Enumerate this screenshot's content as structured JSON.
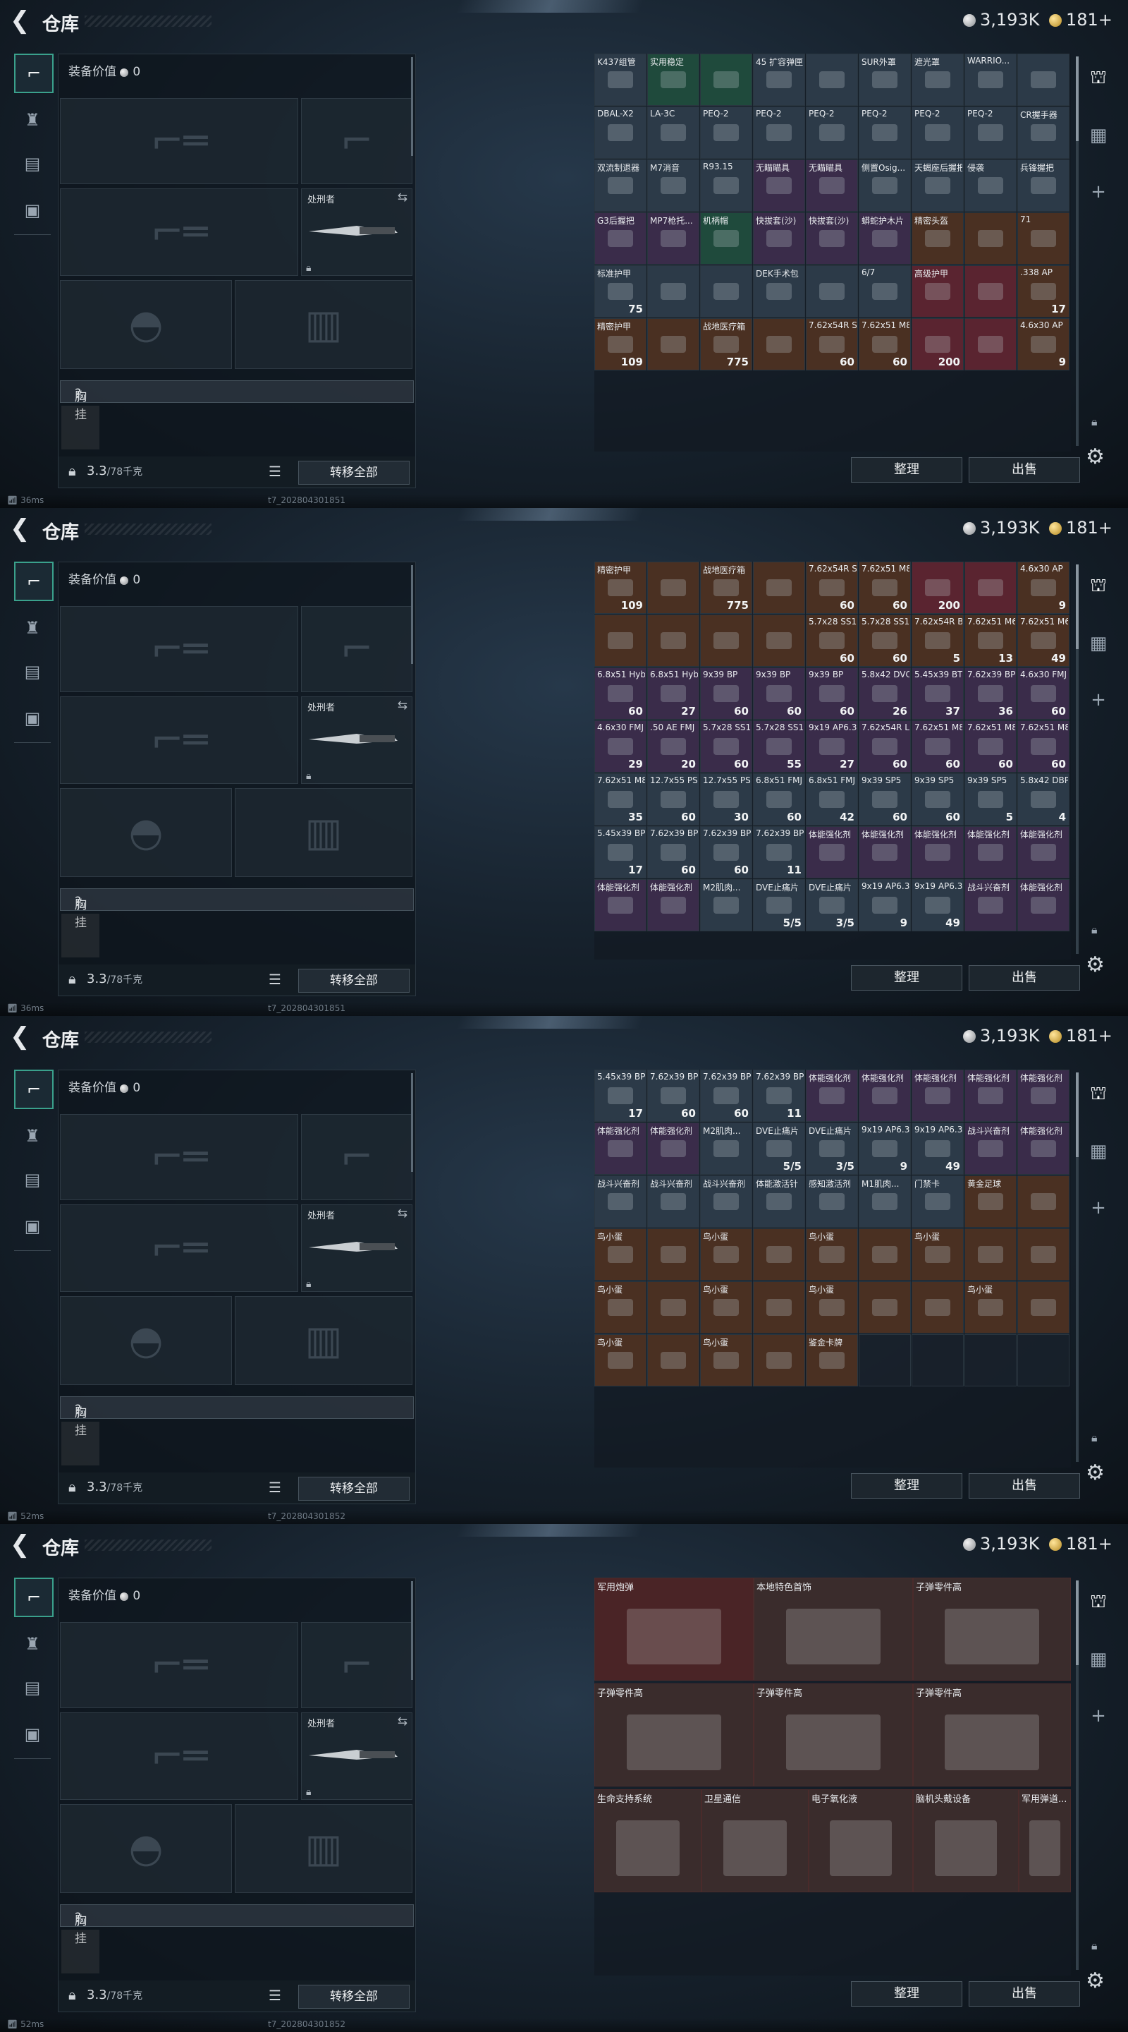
{
  "title": "仓库",
  "currency": {
    "silver": "3,193K",
    "gold": "181+"
  },
  "loadout": {
    "equip_value_label": "装备价值",
    "equip_value": "0",
    "knife_label": "处刑者",
    "vest_label": "胸挂",
    "vest_help": "?",
    "weight": "3.3",
    "weight_cap": "/78千克",
    "transfer_all": "转移全部"
  },
  "buttons": {
    "sort": "整理",
    "sell": "出售"
  },
  "frames": [
    {
      "ping": "36ms",
      "build": "t7_202804301851",
      "cells": [
        {
          "name": "K437组管",
          "color": "#2c3a48"
        },
        {
          "name": "实用稳定",
          "color": "#1f4a3c"
        },
        {
          "name": "",
          "color": "#1f4a3c"
        },
        {
          "name": "45 扩容弹匣",
          "color": "#2c3a48"
        },
        {
          "name": "",
          "color": "#2c3a48"
        },
        {
          "name": "SUR外罩",
          "color": "#2c3a48"
        },
        {
          "name": "遮光罩",
          "color": "#2c3a48"
        },
        {
          "name": "WARRIO...",
          "color": "#2c3a48"
        },
        {
          "name": "",
          "color": "#2c3a48"
        },
        {
          "name": "DBAL-X2",
          "color": "#2c3a48"
        },
        {
          "name": "LA-3C",
          "color": "#2c3a48"
        },
        {
          "name": "PEQ-2",
          "color": "#2c3a48"
        },
        {
          "name": "PEQ-2",
          "color": "#2c3a48"
        },
        {
          "name": "PEQ-2",
          "color": "#2c3a48"
        },
        {
          "name": "PEQ-2",
          "color": "#2c3a48"
        },
        {
          "name": "PEQ-2",
          "color": "#2c3a48"
        },
        {
          "name": "PEQ-2",
          "color": "#2c3a48"
        },
        {
          "name": "CR握手器",
          "color": "#2c3a48"
        },
        {
          "name": "双流制退器",
          "color": "#2c3a48"
        },
        {
          "name": "M7消音",
          "color": "#2c3a48"
        },
        {
          "name": "R93.15",
          "color": "#2c3a48"
        },
        {
          "name": "无瞄瞄具",
          "color": "#3a2c4a"
        },
        {
          "name": "无瞄瞄具",
          "color": "#3a2c4a"
        },
        {
          "name": "侧置Osig...",
          "color": "#2c3a48"
        },
        {
          "name": "天蝎座后握把",
          "color": "#2c3a48"
        },
        {
          "name": "侵袭",
          "color": "#2c3a48"
        },
        {
          "name": "兵锋握把",
          "color": "#2c3a48"
        },
        {
          "name": "G3后握把",
          "color": "#3a2c4a"
        },
        {
          "name": "MP7枪托...",
          "color": "#3a2c4a"
        },
        {
          "name": "机柄帽",
          "color": "#1f4a3c"
        },
        {
          "name": "快拔套(沙)",
          "color": "#3a2c4a"
        },
        {
          "name": "快拔套(沙)",
          "color": "#3a2c4a"
        },
        {
          "name": "蟒蛇护木片",
          "color": "#3a2c4a"
        },
        {
          "name": "精密头盔",
          "color": "#4a3022"
        },
        {
          "name": "",
          "color": "#4a3022"
        },
        {
          "name": "71",
          "color": "#4a3022"
        },
        {
          "name": "标准护甲",
          "color": "#2c3a48",
          "count": "75"
        },
        {
          "name": "",
          "color": "#2c3a48"
        },
        {
          "name": "",
          "color": "#2c3a48"
        },
        {
          "name": "DEK手术包",
          "color": "#2c3a48"
        },
        {
          "name": "",
          "color": "#2c3a48"
        },
        {
          "name": "6/7",
          "color": "#2c3a48"
        },
        {
          "name": "高级护甲",
          "color": "#5a2430"
        },
        {
          "name": "",
          "color": "#5a2430"
        },
        {
          "name": ".338 AP",
          "color": "#4a3022",
          "count": "17"
        },
        {
          "name": "精密护甲",
          "color": "#4a3022",
          "count": "109"
        },
        {
          "name": "",
          "color": "#4a3022"
        },
        {
          "name": "战地医疗箱",
          "color": "#4a3022",
          "count": "775"
        },
        {
          "name": "",
          "color": "#4a3022"
        },
        {
          "name": "7.62x54R SNB",
          "color": "#4a3022",
          "count": "60"
        },
        {
          "name": "7.62x51 M80",
          "color": "#4a3022",
          "count": "60"
        },
        {
          "name": "",
          "color": "#5a2430",
          "count": "200"
        },
        {
          "name": "",
          "color": "#5a2430"
        },
        {
          "name": "4.6x30 AP",
          "color": "#4a3022",
          "count": "9"
        }
      ]
    },
    {
      "ping": "36ms",
      "build": "t7_202804301851",
      "cells": [
        {
          "name": "精密护甲",
          "color": "#4a3022",
          "count": "109"
        },
        {
          "name": "",
          "color": "#4a3022"
        },
        {
          "name": "战地医疗箱",
          "color": "#4a3022",
          "count": "775"
        },
        {
          "name": "",
          "color": "#4a3022"
        },
        {
          "name": "7.62x54R SNB",
          "color": "#4a3022",
          "count": "60"
        },
        {
          "name": "7.62x51 M80",
          "color": "#4a3022",
          "count": "60"
        },
        {
          "name": "",
          "color": "#5a2430",
          "count": "200"
        },
        {
          "name": "",
          "color": "#5a2430"
        },
        {
          "name": "4.6x30 AP",
          "color": "#4a3022",
          "count": "9"
        },
        {
          "name": "",
          "color": "#4a3022"
        },
        {
          "name": "",
          "color": "#4a3022"
        },
        {
          "name": "",
          "color": "#4a3022"
        },
        {
          "name": "",
          "color": "#4a3022"
        },
        {
          "name": "5.7x28 SS193",
          "color": "#4a3022",
          "count": "60"
        },
        {
          "name": "5.7x28 SS190",
          "color": "#4a3022",
          "count": "60"
        },
        {
          "name": "7.62x54R BT",
          "color": "#4a3022",
          "count": "5"
        },
        {
          "name": "7.62x51 M62",
          "color": "#4a3022",
          "count": "13"
        },
        {
          "name": "7.62x51 M61",
          "color": "#4a3022",
          "count": "49"
        },
        {
          "name": "6.8x51 Hybrid",
          "color": "#3a2c4a",
          "count": "60"
        },
        {
          "name": "6.8x51 Hybrid",
          "color": "#3a2c4a",
          "count": "27"
        },
        {
          "name": "9x39 BP",
          "color": "#3a2c4a",
          "count": "60"
        },
        {
          "name": "9x39 BP",
          "color": "#3a2c4a",
          "count": "60"
        },
        {
          "name": "9x39 BP",
          "color": "#3a2c4a",
          "count": "60"
        },
        {
          "name": "5.8x42 DVC",
          "color": "#3a2c4a",
          "count": "26"
        },
        {
          "name": "5.45x39 BT",
          "color": "#3a2c4a",
          "count": "37"
        },
        {
          "name": "7.62x39 BP",
          "color": "#3a2c4a",
          "count": "36"
        },
        {
          "name": "4.6x30 FMJ",
          "color": "#3a2c4a",
          "count": "60"
        },
        {
          "name": "4.6x30 FMJ",
          "color": "#3a2c4a",
          "count": "29"
        },
        {
          "name": ".50 AE FMJ",
          "color": "#3a2c4a",
          "count": "20"
        },
        {
          "name": "5.7x28 SS197",
          "color": "#3a2c4a",
          "count": "60"
        },
        {
          "name": "5.7x28 SS197",
          "color": "#3a2c4a",
          "count": "55"
        },
        {
          "name": "9x19 AP6.3",
          "color": "#3a2c4a",
          "count": "27"
        },
        {
          "name": "7.62x54R LPS",
          "color": "#3a2c4a",
          "count": "60"
        },
        {
          "name": "7.62x51 M80",
          "color": "#3a2c4a",
          "count": "60"
        },
        {
          "name": "7.62x51 M80",
          "color": "#3a2c4a",
          "count": "60"
        },
        {
          "name": "7.62x51 M80",
          "color": "#3a2c4a",
          "count": "60"
        },
        {
          "name": "7.62x51 M80",
          "color": "#2c3a48",
          "count": "35"
        },
        {
          "name": "12.7x55 PS12",
          "color": "#2c3a48",
          "count": "60"
        },
        {
          "name": "12.7x55 PS12",
          "color": "#2c3a48",
          "count": "30"
        },
        {
          "name": "6.8x51 FMJ",
          "color": "#2c3a48",
          "count": "60"
        },
        {
          "name": "6.8x51 FMJ",
          "color": "#2c3a48",
          "count": "42"
        },
        {
          "name": "9x39 SP5",
          "color": "#2c3a48",
          "count": "60"
        },
        {
          "name": "9x39 SP5",
          "color": "#2c3a48",
          "count": "60"
        },
        {
          "name": "9x39 SP5",
          "color": "#2c3a48",
          "count": "5"
        },
        {
          "name": "5.8x42 DBP88",
          "color": "#2c3a48",
          "count": "4"
        },
        {
          "name": "5.45x39 BP",
          "color": "#2c3a48",
          "count": "17"
        },
        {
          "name": "7.62x39 BP",
          "color": "#2c3a48",
          "count": "60"
        },
        {
          "name": "7.62x39 BP",
          "color": "#2c3a48",
          "count": "60"
        },
        {
          "name": "7.62x39 BP",
          "color": "#2c3a48",
          "count": "11"
        },
        {
          "name": "体能强化剂",
          "color": "#3a2c4a"
        },
        {
          "name": "体能强化剂",
          "color": "#3a2c4a"
        },
        {
          "name": "体能强化剂",
          "color": "#3a2c4a"
        },
        {
          "name": "体能强化剂",
          "color": "#3a2c4a"
        },
        {
          "name": "体能强化剂",
          "color": "#3a2c4a"
        },
        {
          "name": "体能强化剂",
          "color": "#3a2c4a"
        },
        {
          "name": "体能强化剂",
          "color": "#3a2c4a"
        },
        {
          "name": "M2肌肉...",
          "color": "#2c3a48"
        },
        {
          "name": "DVE止痛片",
          "color": "#2c3a48",
          "count": "5/5"
        },
        {
          "name": "DVE止痛片",
          "color": "#2c3a48",
          "count": "3/5"
        },
        {
          "name": "9x19 AP6.3",
          "color": "#2c3a48",
          "count": "9"
        },
        {
          "name": "9x19 AP6.3",
          "color": "#2c3a48",
          "count": "49"
        },
        {
          "name": "战斗兴奋剂",
          "color": "#3a2c4a"
        },
        {
          "name": "体能强化剂",
          "color": "#3a2c4a"
        }
      ]
    },
    {
      "ping": "52ms",
      "build": "t7_202804301852",
      "cells": [
        {
          "name": "5.45x39 BP",
          "color": "#2c3a48",
          "count": "17"
        },
        {
          "name": "7.62x39 BP",
          "color": "#2c3a48",
          "count": "60"
        },
        {
          "name": "7.62x39 BP",
          "color": "#2c3a48",
          "count": "60"
        },
        {
          "name": "7.62x39 BP",
          "color": "#2c3a48",
          "count": "11"
        },
        {
          "name": "体能强化剂",
          "color": "#3a2c4a"
        },
        {
          "name": "体能强化剂",
          "color": "#3a2c4a"
        },
        {
          "name": "体能强化剂",
          "color": "#3a2c4a"
        },
        {
          "name": "体能强化剂",
          "color": "#3a2c4a"
        },
        {
          "name": "体能强化剂",
          "color": "#3a2c4a"
        },
        {
          "name": "体能强化剂",
          "color": "#3a2c4a"
        },
        {
          "name": "体能强化剂",
          "color": "#3a2c4a"
        },
        {
          "name": "M2肌肉...",
          "color": "#2c3a48"
        },
        {
          "name": "DVE止痛片",
          "color": "#2c3a48",
          "count": "5/5"
        },
        {
          "name": "DVE止痛片",
          "color": "#2c3a48",
          "count": "3/5"
        },
        {
          "name": "9x19 AP6.3",
          "color": "#2c3a48",
          "count": "9"
        },
        {
          "name": "9x19 AP6.3",
          "color": "#2c3a48",
          "count": "49"
        },
        {
          "name": "战斗兴奋剂",
          "color": "#3a2c4a"
        },
        {
          "name": "体能强化剂",
          "color": "#3a2c4a"
        },
        {
          "name": "战斗兴奋剂",
          "color": "#2c3a48"
        },
        {
          "name": "战斗兴奋剂",
          "color": "#2c3a48"
        },
        {
          "name": "战斗兴奋剂",
          "color": "#2c3a48"
        },
        {
          "name": "体能激活针",
          "color": "#2c3a48"
        },
        {
          "name": "感知激活剂",
          "color": "#2c3a48"
        },
        {
          "name": "M1肌肉...",
          "color": "#2c3a48"
        },
        {
          "name": "门禁卡",
          "color": "#2c3a48"
        },
        {
          "name": "黄金足球",
          "color": "#4a3022"
        },
        {
          "name": "",
          "color": "#4a3022"
        },
        {
          "name": "鸟小蛋",
          "color": "#4a3022"
        },
        {
          "name": "",
          "color": "#4a3022"
        },
        {
          "name": "鸟小蛋",
          "color": "#4a3022"
        },
        {
          "name": "",
          "color": "#4a3022"
        },
        {
          "name": "鸟小蛋",
          "color": "#4a3022"
        },
        {
          "name": "",
          "color": "#4a3022"
        },
        {
          "name": "鸟小蛋",
          "color": "#4a3022"
        },
        {
          "name": "",
          "color": "#4a3022"
        },
        {
          "name": "",
          "color": "#4a3022"
        },
        {
          "name": "鸟小蛋",
          "color": "#4a3022"
        },
        {
          "name": "",
          "color": "#4a3022"
        },
        {
          "name": "鸟小蛋",
          "color": "#4a3022"
        },
        {
          "name": "",
          "color": "#4a3022"
        },
        {
          "name": "鸟小蛋",
          "color": "#4a3022"
        },
        {
          "name": "",
          "color": "#4a3022"
        },
        {
          "name": "",
          "color": "#4a3022"
        },
        {
          "name": "鸟小蛋",
          "color": "#4a3022"
        },
        {
          "name": "",
          "color": "#4a3022"
        },
        {
          "name": "鸟小蛋",
          "color": "#4a3022"
        },
        {
          "name": "",
          "color": "#4a3022"
        },
        {
          "name": "鸟小蛋",
          "color": "#4a3022"
        },
        {
          "name": "",
          "color": "#4a3022"
        },
        {
          "name": "鉴金卡牌",
          "color": "#4a3022"
        },
        {
          "name": "",
          "color": "empty"
        },
        {
          "name": "",
          "color": "empty"
        },
        {
          "name": "",
          "color": "empty"
        },
        {
          "name": "",
          "color": "empty"
        }
      ]
    },
    {
      "ping": "52ms",
      "build": "t7_202804301852",
      "big": [
        {
          "name": "军用炮弹",
          "color": "#4a2426"
        },
        {
          "name": "本地特色首饰",
          "color": "#3a2c2c"
        },
        {
          "name": "子弹零件高",
          "color": "#3a2c2c"
        },
        {
          "name": "子弹零件高",
          "color": "#3a2c2c"
        },
        {
          "name": "子弹零件高",
          "color": "#3a2c2c"
        },
        {
          "name": "子弹零件高",
          "color": "#3a2c2c"
        },
        {
          "name": "生命支持系统",
          "color": "#3a2c2c"
        },
        {
          "name": "卫星通信",
          "color": "#3a2c2c"
        },
        {
          "name": "电子氧化液",
          "color": "#3a2c2c"
        },
        {
          "name": "脑机头戴设备",
          "color": "#3a2c2c"
        },
        {
          "name": "军用弹道...",
          "color": "#3a2c2c"
        }
      ]
    }
  ]
}
